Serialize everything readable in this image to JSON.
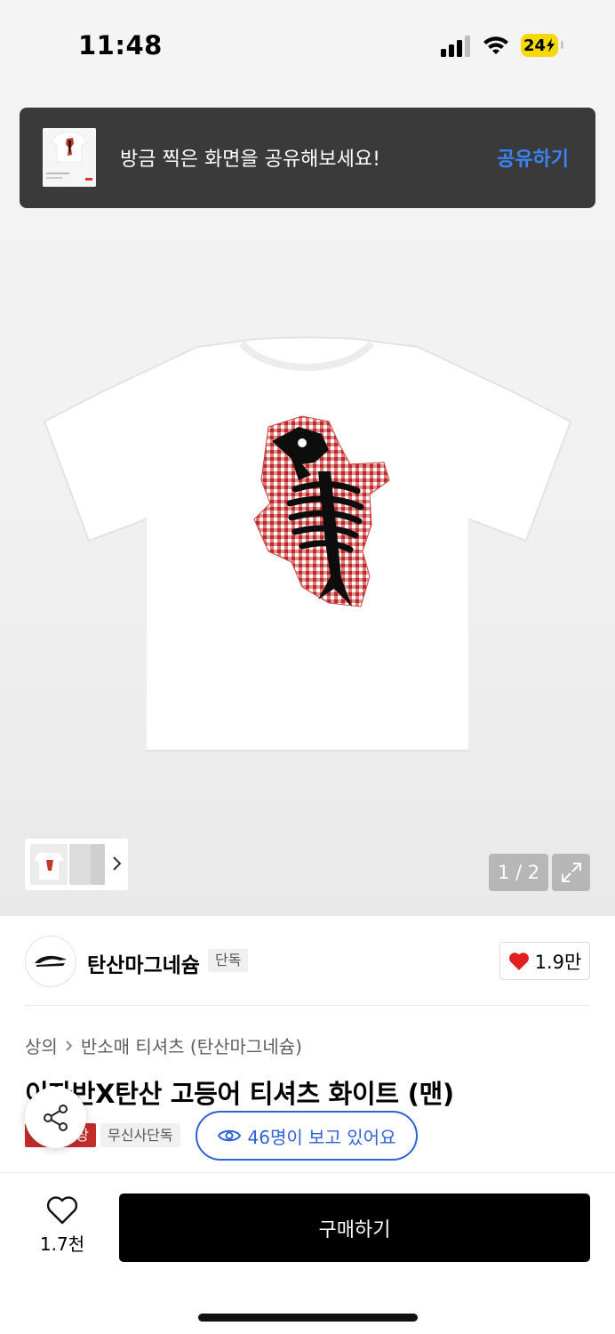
{
  "status_bar": {
    "time": "11:48",
    "battery": "24"
  },
  "toast": {
    "message": "방금 찍은 화면을 공유해보세요!",
    "action": "공유하기"
  },
  "gallery": {
    "counter": "1 / 2"
  },
  "brand": {
    "name": "탄산마그네슘",
    "tag": "단독",
    "likes": "1.9만"
  },
  "breadcrumb": {
    "category": "상의",
    "subcategory": "반소매 티셔츠 (탄산마그네슘)"
  },
  "product": {
    "title": "이자반X탄산 고등어 티셔츠 화이트 (맨)",
    "tag_red": "",
    "tag_red_tail": "상",
    "tag_gray": "무신사단독",
    "viewers": "46명이 보고 있어요"
  },
  "bottom": {
    "wish_count": "1.7천",
    "buy_label": "구매하기"
  },
  "colors": {
    "accent_blue": "#2f62d6",
    "toast_bg": "#3a3a3a",
    "like_red": "#e02020",
    "buy_bg": "#000000"
  }
}
